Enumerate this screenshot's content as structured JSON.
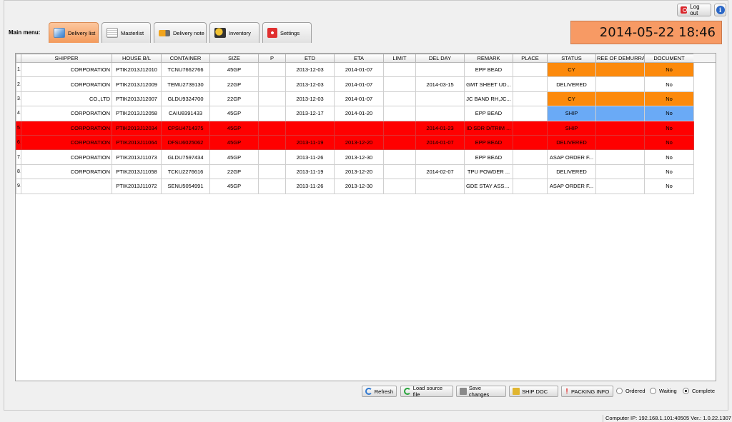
{
  "header": {
    "logout_label": "Log out",
    "info_icon": "i",
    "menu_label": "Main menu:",
    "clock": "2014-05-22 18:46"
  },
  "tabs": [
    {
      "label": "Delivery list",
      "icon": "delivery-list-icon",
      "active": true
    },
    {
      "label": "Masterlist",
      "icon": "masterlist-icon",
      "active": false
    },
    {
      "label": "Delivery note",
      "icon": "truck-icon",
      "active": false
    },
    {
      "label": "Inventory",
      "icon": "forklift-icon",
      "active": false
    },
    {
      "label": "Settings",
      "icon": "gears-icon",
      "active": false
    }
  ],
  "table": {
    "columns": [
      "",
      "SHIPPER",
      "HOUSE B/L",
      "CONTAINER",
      "SIZE",
      "P",
      "ETD",
      "ETA",
      "LIMIT",
      "DEL DAY",
      "REMARK",
      "PLACE",
      "STATUS",
      "REE OF DEMURRAG",
      "DOCUMENT"
    ],
    "rows": [
      {
        "n": "1",
        "shipper": "CORPORATION",
        "hbl": "PTIK2013J12010",
        "container": "TCNU7662766",
        "size": "45GP",
        "p": "",
        "etd": "2013-12-03",
        "eta": "2014-01-07",
        "limit": "",
        "delday": "",
        "remark": "EPP BEAD",
        "place": "",
        "status": "CY",
        "free": "",
        "doc": "No",
        "style": "cy"
      },
      {
        "n": "2",
        "shipper": "CORPORATION",
        "hbl": "PTIK2013J12009",
        "container": "TEMU2739130",
        "size": "22GP",
        "p": "",
        "etd": "2013-12-03",
        "eta": "2014-01-07",
        "limit": "",
        "delday": "2014-03-15",
        "remark": "GMT SHEET UD...",
        "place": "",
        "status": "DELIVERED",
        "free": "",
        "doc": "No",
        "style": "normal"
      },
      {
        "n": "3",
        "shipper": "CO.,LTD",
        "hbl": "PTIK2013J12007",
        "container": "GLDU9324700",
        "size": "22GP",
        "p": "",
        "etd": "2013-12-03",
        "eta": "2014-01-07",
        "limit": "",
        "delday": "",
        "remark": "JC BAND RH,JC...",
        "place": "",
        "status": "CY",
        "free": "",
        "doc": "No",
        "style": "cy"
      },
      {
        "n": "4",
        "shipper": "CORPORATION",
        "hbl": "PTIK2013J12058",
        "container": "CAIU8391433",
        "size": "45GP",
        "p": "",
        "etd": "2013-12-17",
        "eta": "2014-01-20",
        "limit": "",
        "delday": "",
        "remark": "EPP BEAD",
        "place": "",
        "status": "SHIP",
        "free": "",
        "doc": "No",
        "style": "ship"
      },
      {
        "n": "5",
        "shipper": "CORPORATION",
        "hbl": "PTIK2013J12034",
        "container": "CPSU4714375",
        "size": "45GP",
        "p": "",
        "etd": "",
        "eta": "",
        "limit": "",
        "delday": "2014-01-23",
        "remark": "ID SDR D/TRIM ...",
        "place": "",
        "status": "SHIP",
        "free": "",
        "doc": "No",
        "style": "red"
      },
      {
        "n": "6",
        "shipper": "CORPORATION",
        "hbl": "PTIK2013J11064",
        "container": "DFSU6025062",
        "size": "45GP",
        "p": "",
        "etd": "2013-11-19",
        "eta": "2013-12-20",
        "limit": "",
        "delday": "2014-01-07",
        "remark": "EPP BEAD",
        "place": "",
        "status": "DELIVERED",
        "free": "",
        "doc": "No",
        "style": "red"
      },
      {
        "n": "7",
        "shipper": "CORPORATION",
        "hbl": "PTIK2013J11073",
        "container": "GLDU7597434",
        "size": "45GP",
        "p": "",
        "etd": "2013-11-26",
        "eta": "2013-12-30",
        "limit": "",
        "delday": "",
        "remark": "EPP BEAD",
        "place": "",
        "status": "ASAP ORDER F...",
        "free": "",
        "doc": "No",
        "style": "normal"
      },
      {
        "n": "8",
        "shipper": "CORPORATION",
        "hbl": "PTIK2013J11058",
        "container": "TCKU2276616",
        "size": "22GP",
        "p": "",
        "etd": "2013-11-19",
        "eta": "2013-12-20",
        "limit": "",
        "delday": "2014-02-07",
        "remark": "TPU POWDER ...",
        "place": "",
        "status": "DELIVERED",
        "free": "",
        "doc": "No",
        "style": "normal"
      },
      {
        "n": "9",
        "shipper": "",
        "hbl": "PTIK2013J11072",
        "container": "SENU5054991",
        "size": "45GP",
        "p": "",
        "etd": "2013-11-26",
        "eta": "2013-12-30",
        "limit": "",
        "delday": "",
        "remark": "GDE STAY ASSY...",
        "place": "",
        "status": "ASAP ORDER F...",
        "free": "",
        "doc": "No",
        "style": "normal"
      }
    ]
  },
  "actions": {
    "refresh": "Refresh",
    "load": "Load source file",
    "save": "Save changes",
    "ship_doc": "SHIP DOC",
    "packing": "PACKING INFO",
    "packing_icon": "!"
  },
  "filters": [
    {
      "label": "Ordered",
      "checked": false
    },
    {
      "label": "Waiting",
      "checked": false
    },
    {
      "label": "Complete",
      "checked": true
    }
  ],
  "statusbar": {
    "text": "Computer IP: 192.168.1.101:40505   Ver.: 1.0.22.1307"
  },
  "colors": {
    "accent": "#f79a64",
    "cy": "#fc8a0c",
    "ship": "#6aaaf6",
    "overdue": "#ff0000"
  }
}
